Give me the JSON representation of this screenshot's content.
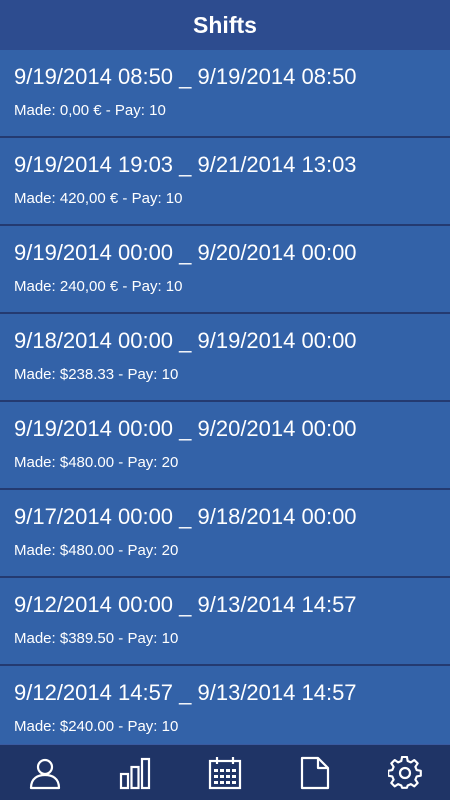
{
  "header": {
    "title": "Shifts"
  },
  "shifts": [
    {
      "range": "9/19/2014 08:50 _ 9/19/2014 08:50",
      "made_label": "Made: ",
      "made": "0,00 €",
      "sep": " - ",
      "pay_label": "Pay: ",
      "pay": "10"
    },
    {
      "range": "9/19/2014 19:03 _ 9/21/2014 13:03",
      "made_label": "Made: ",
      "made": "420,00 €",
      "sep": " - ",
      "pay_label": "Pay: ",
      "pay": "10"
    },
    {
      "range": "9/19/2014 00:00 _ 9/20/2014 00:00",
      "made_label": "Made: ",
      "made": "240,00 €",
      "sep": " - ",
      "pay_label": "Pay: ",
      "pay": "10"
    },
    {
      "range": "9/18/2014 00:00 _ 9/19/2014 00:00",
      "made_label": "Made: ",
      "made": "$238.33",
      "sep": " - ",
      "pay_label": "Pay: ",
      "pay": "10"
    },
    {
      "range": "9/19/2014 00:00 _ 9/20/2014 00:00",
      "made_label": "Made: ",
      "made": "$480.00",
      "sep": " - ",
      "pay_label": "Pay: ",
      "pay": "20"
    },
    {
      "range": "9/17/2014 00:00 _ 9/18/2014 00:00",
      "made_label": "Made: ",
      "made": "$480.00",
      "sep": " - ",
      "pay_label": "Pay: ",
      "pay": "20"
    },
    {
      "range": "9/12/2014 00:00 _ 9/13/2014 14:57",
      "made_label": "Made: ",
      "made": "$389.50",
      "sep": " - ",
      "pay_label": "Pay: ",
      "pay": "10"
    },
    {
      "range": "9/12/2014 14:57 _ 9/13/2014 14:57",
      "made_label": "Made: ",
      "made": "$240.00",
      "sep": " - ",
      "pay_label": "Pay: ",
      "pay": "10"
    }
  ],
  "bottom_nav": [
    {
      "icon": "user-icon"
    },
    {
      "icon": "bar-chart-icon"
    },
    {
      "icon": "calendar-icon"
    },
    {
      "icon": "document-icon"
    },
    {
      "icon": "gear-icon"
    }
  ],
  "colors": {
    "header_bg": "#2d4c8f",
    "row_bg": "#3362a8",
    "divider": "#243a70",
    "nav_bg": "#1f3466",
    "text": "#ffffff"
  }
}
